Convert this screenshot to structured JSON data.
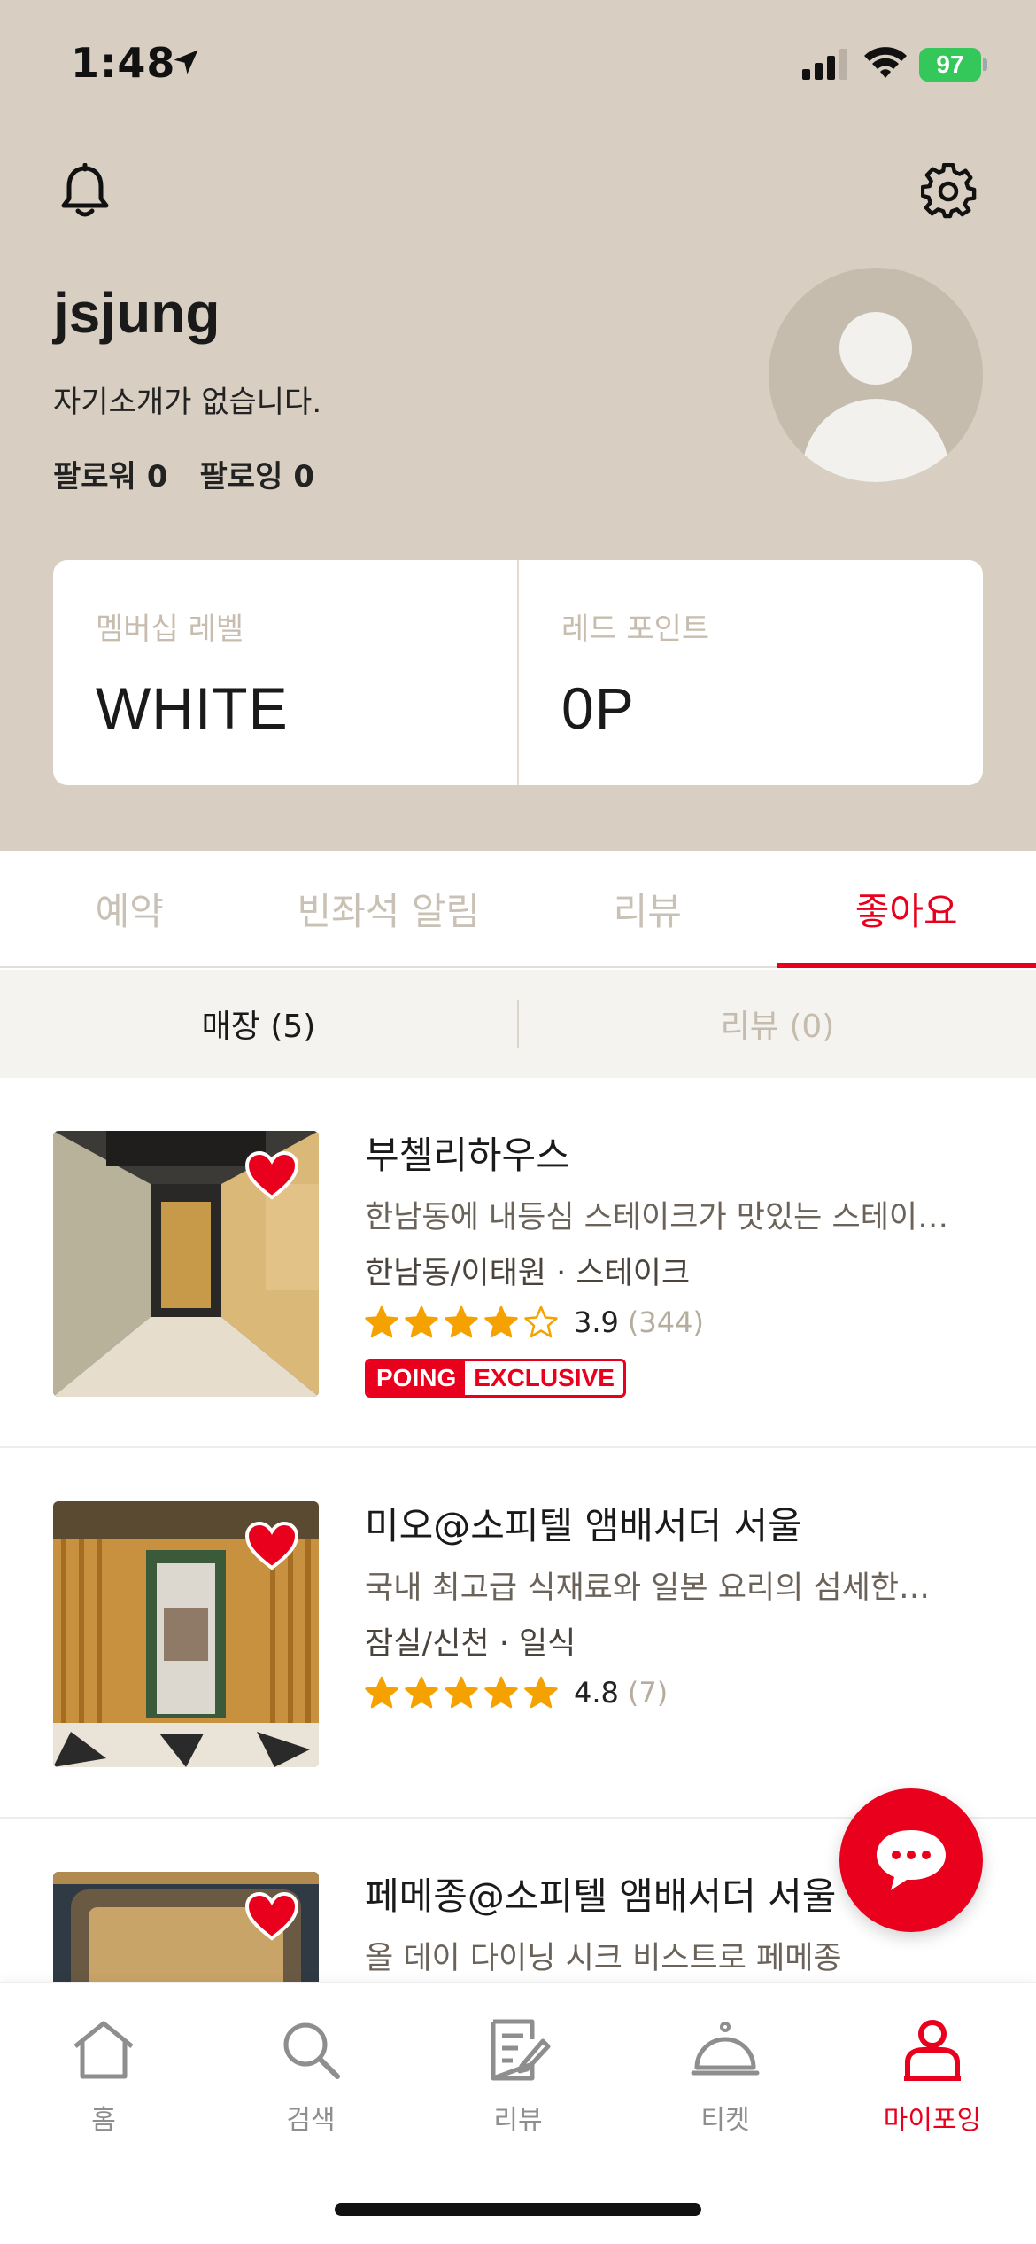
{
  "status_bar": {
    "time": "1:48",
    "battery": "97"
  },
  "profile": {
    "username": "jsjung",
    "bio": "자기소개가 없습니다.",
    "followers_label": "팔로워",
    "followers_count": "0",
    "following_label": "팔로잉",
    "following_count": "0"
  },
  "stats": {
    "membership_label": "멤버십 레벨",
    "membership_value": "WHITE",
    "points_label": "레드 포인트",
    "points_value": "0P"
  },
  "tabs": [
    {
      "label": "예약",
      "active": false
    },
    {
      "label": "빈좌석 알림",
      "active": false
    },
    {
      "label": "리뷰",
      "active": false
    },
    {
      "label": "좋아요",
      "active": true
    }
  ],
  "subtabs": [
    {
      "label": "매장 (5)",
      "active": true
    },
    {
      "label": "리뷰 (0)",
      "active": false
    }
  ],
  "stores": [
    {
      "name": "부첼리하우스",
      "description": "한남동에 내등심 스테이크가 맛있는 스테이…",
      "category": "한남동/이태원 · 스테이크",
      "rating": "3.9",
      "rating_value": 3.9,
      "review_count": "(344)",
      "badge_left": "POING",
      "badge_right": "EXCLUSIVE",
      "has_badge": true
    },
    {
      "name": "미오@소피텔 앰배서더 서울",
      "description": "국내 최고급 식재료와 일본 요리의 섬세한…",
      "category": "잠실/신천 · 일식",
      "rating": "4.8",
      "rating_value": 4.8,
      "review_count": "(7)",
      "has_badge": false
    },
    {
      "name": "페메종@소피텔 앰배서더 서울",
      "description": "올 데이 다이닝 시크 비스트로 페메종"
    }
  ],
  "bottom_nav": [
    {
      "label": "홈",
      "icon": "home-icon",
      "active": false
    },
    {
      "label": "검색",
      "icon": "search-icon",
      "active": false
    },
    {
      "label": "리뷰",
      "icon": "review-icon",
      "active": false
    },
    {
      "label": "티켓",
      "icon": "ticket-icon",
      "active": false
    },
    {
      "label": "마이포잉",
      "icon": "profile-icon",
      "active": true
    }
  ],
  "colors": {
    "accent": "#e8001c",
    "header_bg": "#d8cfc2",
    "star": "#f5a200"
  }
}
